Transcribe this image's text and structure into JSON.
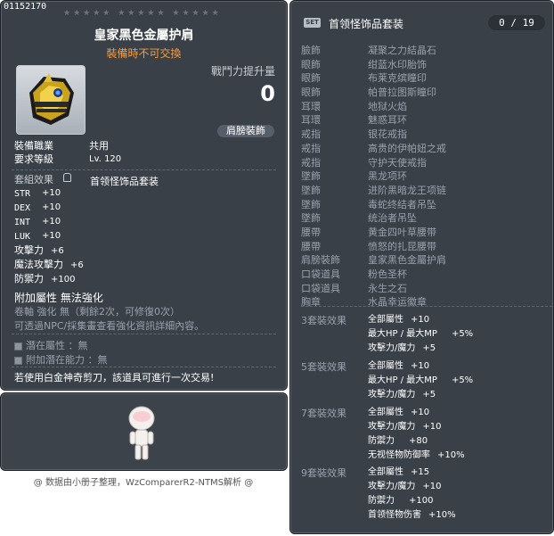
{
  "item_id": "01152170",
  "item": {
    "title": "皇家黑色金屬护肩",
    "tradable_note": "裝備時不可交換",
    "power_label": "戰鬥力提升量",
    "power_value": "0",
    "slot_badge": "肩膀裝飾",
    "job_label": "裝備職業",
    "job_value": "共用",
    "level_label": "要求等級",
    "level_value": "Lv. 120",
    "set_effect_label": "套組效果",
    "set_name": "首领怪饰品套装",
    "stats": [
      {
        "label": "STR",
        "value": "+10"
      },
      {
        "label": "DEX",
        "value": "+10"
      },
      {
        "label": "INT",
        "value": "+10"
      },
      {
        "label": "LUK",
        "value": "+10"
      },
      {
        "label": "攻擊力",
        "value": "+6"
      },
      {
        "label": "魔法攻擊力",
        "value": "+6"
      },
      {
        "label": "防禦力",
        "value": "+100"
      }
    ],
    "additional_attr": "附加屬性 無法強化",
    "scroll_line": "卷軸 強化 無（剩餘2次，可修復0次）",
    "npc_line": "可透過NPC/採集畫查看強化資訊詳細內容。",
    "potential_label": "潛在屬性",
    "potential_value": "：無",
    "add_potential_label": "附加潛在能力",
    "add_potential_value": "：無",
    "scissors_note": "若使用白金神奇剪刀，該道具可進行一次交易!"
  },
  "credit": "@ 数据由小册子整理，WzComparerR2-NTMS解析 @",
  "set_panel": {
    "badge": "SET",
    "title": "首领怪饰品套装",
    "count": "0 / 19",
    "items": [
      {
        "slot": "臉飾",
        "name": "凝聚之力結晶石"
      },
      {
        "slot": "眼飾",
        "name": "绀蓝水印胎饰"
      },
      {
        "slot": "眼飾",
        "name": "布莱克缤瞳印"
      },
      {
        "slot": "眼飾",
        "name": "帕普拉图斯瞳印"
      },
      {
        "slot": "耳環",
        "name": "地狱火焰"
      },
      {
        "slot": "耳環",
        "name": "魅惑耳环"
      },
      {
        "slot": "戒指",
        "name": "银花戒指"
      },
      {
        "slot": "戒指",
        "name": "高贵的伊帕妞之戒"
      },
      {
        "slot": "戒指",
        "name": "守护天使戒指"
      },
      {
        "slot": "墜飾",
        "name": "黑龙项环"
      },
      {
        "slot": "墜飾",
        "name": "进阶黑暗龙王项链"
      },
      {
        "slot": "墜飾",
        "name": "毒蛇终结者吊坠"
      },
      {
        "slot": "墜飾",
        "name": "统治者吊坠"
      },
      {
        "slot": "腰帶",
        "name": "黄金四叶草腰带"
      },
      {
        "slot": "腰帶",
        "name": "愤怒的扎昆腰带"
      },
      {
        "slot": "肩膀裝飾",
        "name": "皇家黑色金屬护肩"
      },
      {
        "slot": "口袋道具",
        "name": "粉色圣杯"
      },
      {
        "slot": "口袋道具",
        "name": "永生之石"
      },
      {
        "slot": "胸章",
        "name": "水晶幸运徽章"
      }
    ],
    "bonuses": [
      {
        "label": "3套裝效果",
        "lines": [
          [
            "全部屬性",
            "+10",
            ""
          ],
          [
            "最大HP / 最大MP",
            "+5%",
            "wide"
          ],
          [
            "攻擊力/魔力",
            "+5",
            ""
          ]
        ]
      },
      {
        "label": "5套裝效果",
        "lines": [
          [
            "全部屬性",
            "+10",
            ""
          ],
          [
            "最大HP / 最大MP",
            "+5%",
            "wide"
          ],
          [
            "攻擊力/魔力",
            "+5",
            ""
          ]
        ]
      },
      {
        "label": "7套裝效果",
        "lines": [
          [
            "全部屬性",
            "+10",
            ""
          ],
          [
            "攻擊力/魔力",
            "+10",
            ""
          ],
          [
            "防禦力",
            "+80",
            "wide"
          ],
          [
            "无视怪物防御率",
            "+10%",
            ""
          ]
        ]
      },
      {
        "label": "9套裝效果",
        "lines": [
          [
            "全部屬性",
            "+15",
            ""
          ],
          [
            "攻擊力/魔力",
            "+10",
            ""
          ],
          [
            "防禦力",
            "+100",
            "wide"
          ],
          [
            "首领怪物伤害",
            "+10%",
            ""
          ]
        ]
      }
    ]
  }
}
